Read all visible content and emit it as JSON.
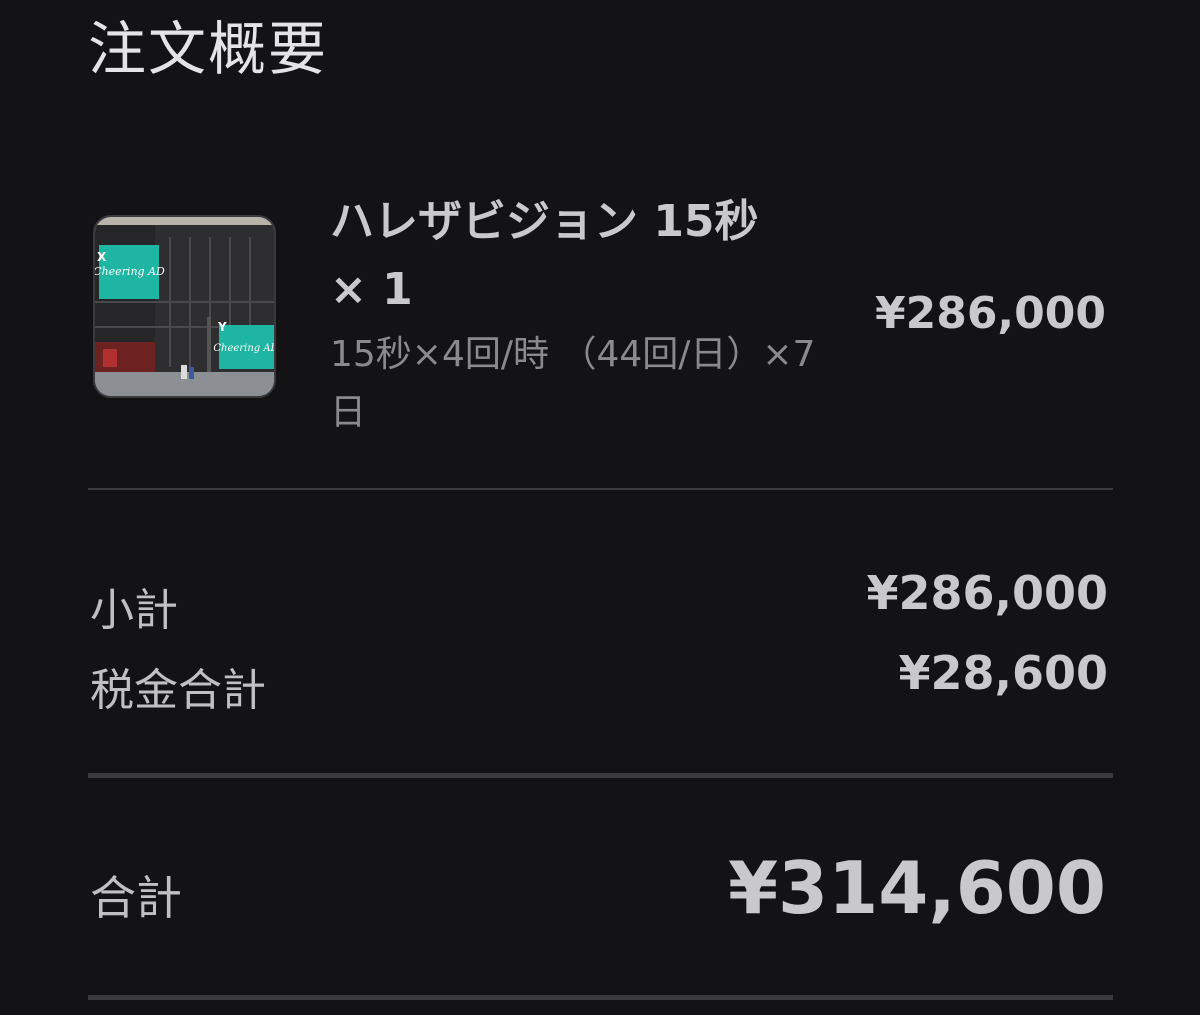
{
  "header": {
    "title": "注文概要"
  },
  "item": {
    "name": "ハレザビジョン 15秒 × 1",
    "detail": "15秒×4回/時 （44回/日）×7日",
    "price": "¥286,000",
    "thumbnail": {
      "icon": "billboard-image",
      "screen_text": "Cheering AD",
      "marker_x": "X",
      "marker_y": "Y",
      "accent": "#1fb5a3"
    }
  },
  "summary": {
    "subtotal_label": "小計",
    "subtotal_value": "¥286,000",
    "tax_label": "税金合計",
    "tax_value": "¥28,600"
  },
  "total": {
    "label": "合計",
    "value": "¥314,600"
  }
}
